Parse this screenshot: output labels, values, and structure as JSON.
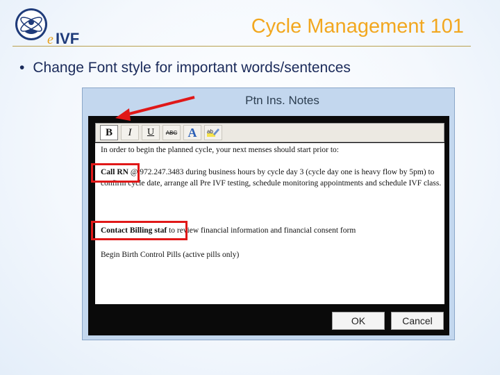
{
  "logo": {
    "brand_text": "eIVF"
  },
  "slide": {
    "title": "Cycle Management 101",
    "bullet_char": "•",
    "bullet_text": "Change Font style for important words/sentences"
  },
  "dialog": {
    "title": "Ptn Ins. Notes",
    "toolbar": {
      "bold": "B",
      "italic": "I",
      "underline": "U",
      "strikethrough": "ABC",
      "font_color": "A",
      "highlight": "ab"
    },
    "notes": {
      "line1": "In order to begin the planned cycle, your next menses should start prior to:",
      "call_rn": "Call RN",
      "call_rn_rest": " @ 972.247.3483 during business hours by cycle day 3 (cycle day one is heavy flow by 5pm) to confirm cycle date, arrange all Pre IVF testing, schedule monitoring appointments and schedule IVF class.",
      "contact_billing": "Contact Billing staf",
      "contact_billing_rest": " to review financial information and financial consent form",
      "birth_control": "Begin Birth Control Pills (active pills only)"
    },
    "buttons": {
      "ok": "OK",
      "cancel": "Cancel"
    }
  },
  "colors": {
    "title": "#f2a71f",
    "bullet_text": "#1a2a5a",
    "highlight_box": "#e01818",
    "dialog_bg": "#c3d7ee"
  }
}
